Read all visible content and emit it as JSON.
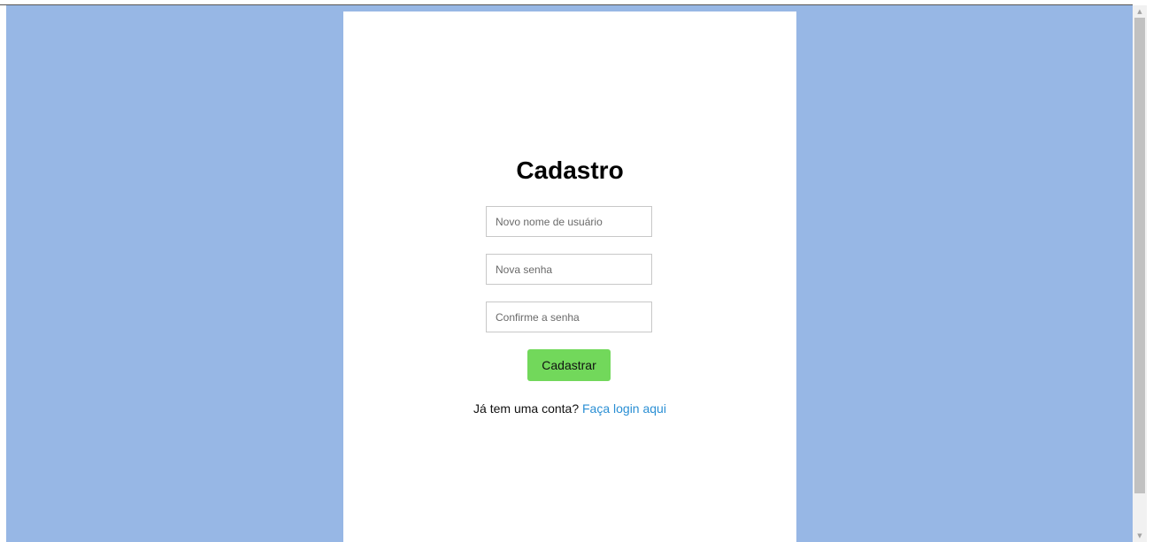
{
  "colors": {
    "page_background": "#97b7e5",
    "card_background": "#ffffff",
    "button_background": "#72d85b",
    "link": "#2a8fd4"
  },
  "form": {
    "title": "Cadastro",
    "username_placeholder": "Novo nome de usuário",
    "password_placeholder": "Nova senha",
    "confirm_placeholder": "Confirme a senha",
    "submit_label": "Cadastrar",
    "login_prompt": "Já tem uma conta?",
    "login_link": "Faça login aqui"
  },
  "icons": {
    "scroll_up": "chevron-up-icon",
    "scroll_down": "chevron-down-icon"
  }
}
